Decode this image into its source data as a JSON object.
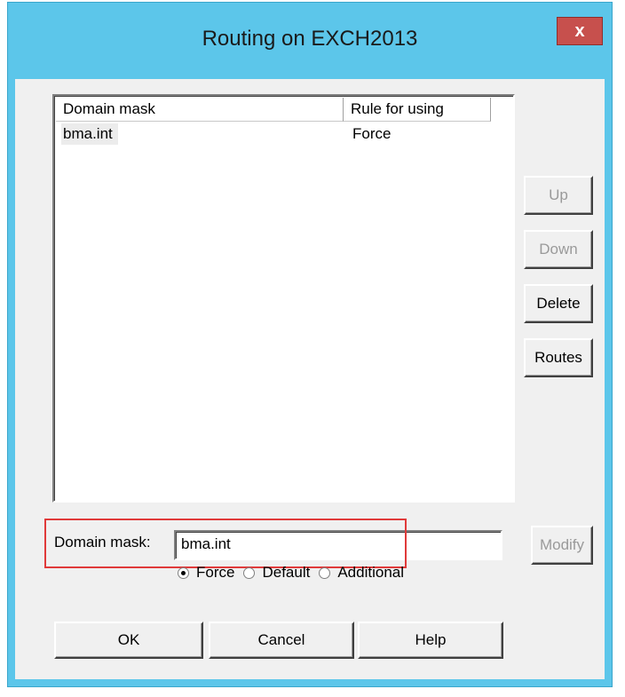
{
  "window": {
    "title": "Routing on EXCH2013",
    "close_label": "x"
  },
  "listview": {
    "columns": [
      "Domain mask",
      "Rule for using"
    ],
    "rows": [
      {
        "domain_mask": "bma.int",
        "rule": "Force"
      }
    ]
  },
  "side_buttons": {
    "up": "Up",
    "down": "Down",
    "delete": "Delete",
    "routes": "Routes"
  },
  "domain_mask_field": {
    "label": "Domain mask:",
    "value": "bma.int"
  },
  "modify_label": "Modify",
  "rule_options": {
    "force": "Force",
    "default": "Default",
    "additional": "Additional",
    "selected": "Force"
  },
  "footer_buttons": {
    "ok": "OK",
    "cancel": "Cancel",
    "help": "Help"
  },
  "colors": {
    "titlebar": "#5cc6ea",
    "close": "#c7504d",
    "highlight": "#e03a3a"
  }
}
